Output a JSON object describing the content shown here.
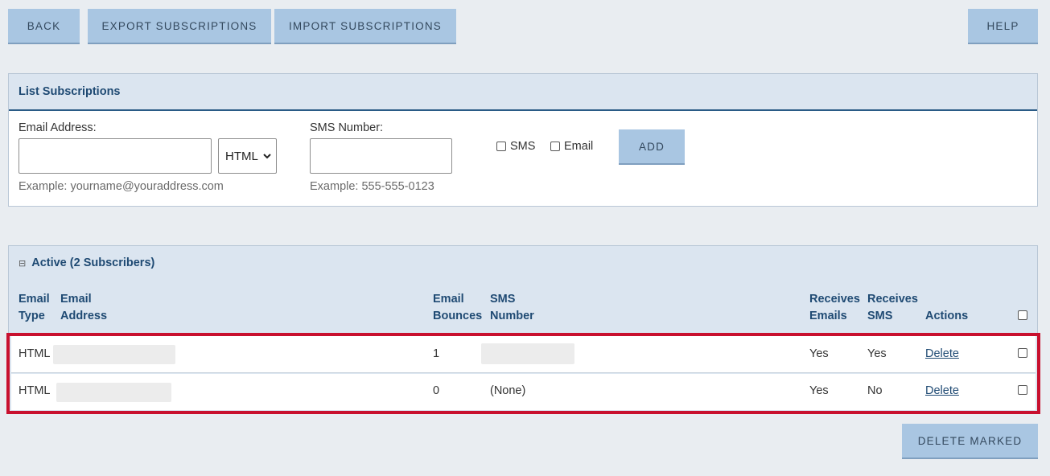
{
  "toolbar": {
    "back_label": "BACK",
    "export_label": "EXPORT SUBSCRIPTIONS",
    "import_label": "IMPORT SUBSCRIPTIONS",
    "help_label": "HELP"
  },
  "list_panel": {
    "title": "List Subscriptions",
    "email_label": "Email Address:",
    "email_value": "",
    "email_hint": "Example: yourname@youraddress.com",
    "format_selected": "HTML",
    "sms_label": "SMS Number:",
    "sms_value": "",
    "sms_hint": "Example: 555-555-0123",
    "sms_checkbox_label": "SMS",
    "email_checkbox_label": "Email",
    "add_label": "ADD"
  },
  "active_panel": {
    "title": "Active (2 Subscribers)",
    "collapse_icon": "⊟",
    "columns": {
      "email_type_1": "Email",
      "email_type_2": "Type",
      "email_address_1": "Email",
      "email_address_2": "Address",
      "bounces_1": "Email",
      "bounces_2": "Bounces",
      "sms_1": "SMS",
      "sms_2": "Number",
      "receives_emails_1": "Receives",
      "receives_emails_2": "Emails",
      "receives_sms_1": "Receives",
      "receives_sms_2": "SMS",
      "actions": "Actions"
    },
    "rows": [
      {
        "type": "HTML",
        "bounces": "1",
        "sms": "",
        "receives_emails": "Yes",
        "receives_sms": "Yes",
        "action": "Delete"
      },
      {
        "type": "HTML",
        "bounces": "0",
        "sms": "(None)",
        "receives_emails": "Yes",
        "receives_sms": "No",
        "action": "Delete"
      }
    ],
    "delete_marked_label": "DELETE MARKED"
  },
  "colors": {
    "button_bg": "#a9c6e2",
    "panel_header_bg": "#dbe5f0",
    "heading_text": "#1f4a73",
    "highlight_border": "#c8102e"
  }
}
